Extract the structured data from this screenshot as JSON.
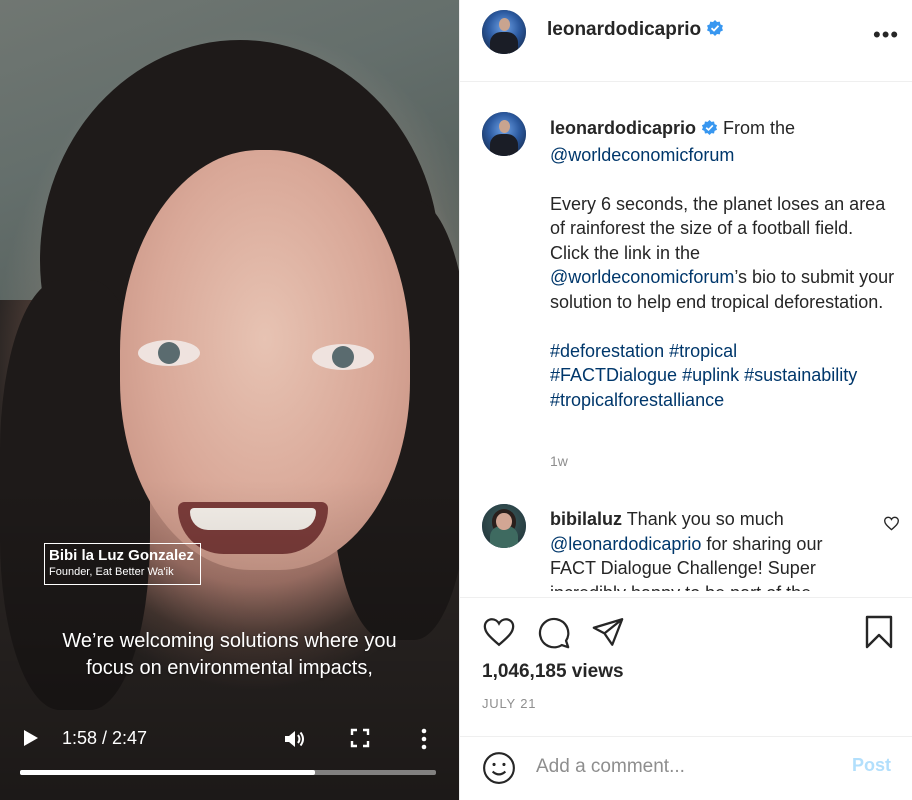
{
  "video": {
    "name_tag": {
      "name": "Bibi la Luz Gonzalez",
      "role": "Founder, Eat Better Wa'ik"
    },
    "caption_line1": "We’re welcoming solutions where you",
    "caption_line2": "focus on environmental impacts,",
    "time": "1:58 / 2:47",
    "progress": 0.71,
    "icons": [
      "play-icon",
      "volume-icon",
      "fullscreen-icon",
      "more-vertical-icon"
    ]
  },
  "header": {
    "username": "leonardodicaprio",
    "more": "•••"
  },
  "post": {
    "username": "leonardodicaprio",
    "from": "From the",
    "mention1": "@worldeconomicforum",
    "text_a": "Every 6 seconds, the planet loses an area of rainforest the size of a football field. Click the link in the",
    "mention2": "@worldeconomicforum",
    "text_b": "’s bio to submit your solution to help end tropical deforestation.",
    "hashtags": [
      "#deforestation",
      "#tropical",
      "#FACTDialogue",
      "#uplink",
      "#sustainability",
      "#tropicalforestalliance"
    ],
    "ago": "1w"
  },
  "comment": {
    "username": "bibilaluz",
    "text_a": "Thank you so much",
    "mention": "@leonardodicaprio",
    "text_b": "for sharing our FACT Dialogue Challenge! Super incredibly happy to be part of the"
  },
  "stats": {
    "views": "1,046,185 views",
    "date": "JULY 21"
  },
  "add_comment": {
    "placeholder": "Add a comment...",
    "post_label": "Post"
  },
  "colors": {
    "link": "#00376b",
    "verified": "#3897f0",
    "post_disabled": "#b2dffc",
    "muted": "#8e8e8e"
  }
}
